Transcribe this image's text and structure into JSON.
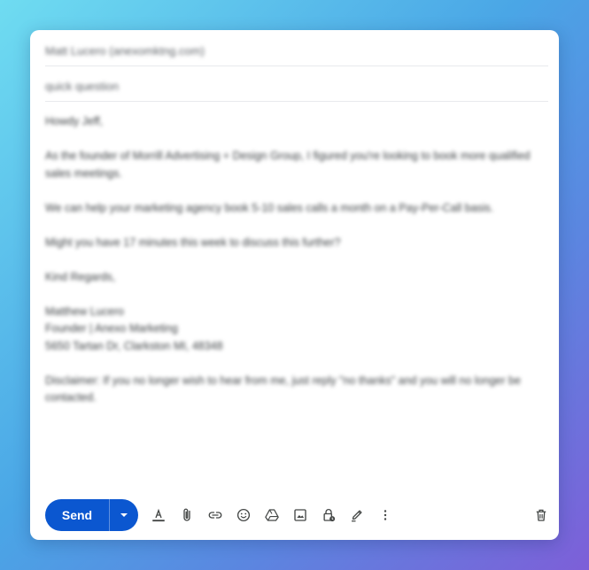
{
  "compose": {
    "to": "Matt Lucero (anexomktng.com)",
    "subject": "quick question",
    "body": {
      "greeting": "Howdy Jeff,",
      "paragraph1": "As the founder of Morrill Advertising + Design Group, I figured you're looking to book more qualified sales meetings.",
      "paragraph2": "We can help your marketing agency book 5-10 sales calls a month on a Pay-Per-Call basis.",
      "paragraph3": "Might you have 17 minutes this week to discuss this further?",
      "closing": "Kind Regards,",
      "signature_name": "Matthew Lucero",
      "signature_title": "Founder | Anexo Marketing",
      "signature_address": "5650 Tartan Dr, Clarkston MI, 48348",
      "disclaimer": "Disclaimer: If you no longer wish to hear from me, just reply \"no thanks\" and you will no longer be contacted."
    }
  },
  "toolbar": {
    "send_label": "Send",
    "icons": [
      "send-options-icon",
      "format-text-icon",
      "attach-icon",
      "link-icon",
      "emoji-icon",
      "drive-icon",
      "image-icon",
      "confidential-lock-icon",
      "signature-pen-icon",
      "more-options-icon",
      "delete-icon"
    ]
  },
  "colors": {
    "send_button": "#0b57d0",
    "icon": "#444746"
  }
}
